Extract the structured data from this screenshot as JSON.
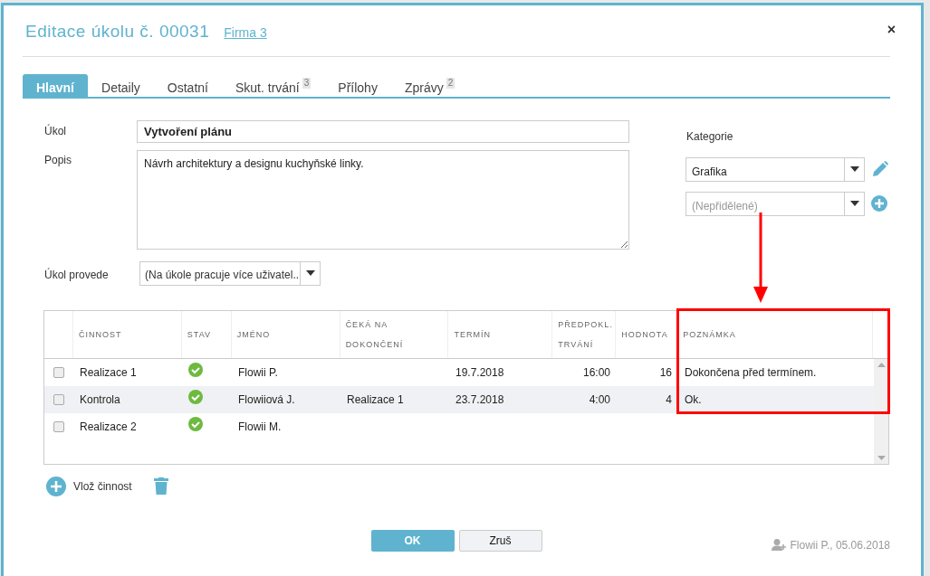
{
  "dialog": {
    "title": "Editace úkolu č. 00031",
    "company_link": "Firma 3",
    "close": "×"
  },
  "tabs": [
    {
      "label": "Hlavní",
      "selected": true
    },
    {
      "label": "Detaily",
      "selected": false
    },
    {
      "label": "Ostatní",
      "selected": false
    },
    {
      "label": "Skut. trvání",
      "badge": "3",
      "selected": false
    },
    {
      "label": "Přílohy",
      "selected": false
    },
    {
      "label": "Zprávy",
      "badge": "2",
      "selected": false
    }
  ],
  "form": {
    "task_label": "Úkol",
    "task_value": "Vytvoření plánu",
    "description_label": "Popis",
    "description_value": "Návrh architektury a designu kuchyňské linky.",
    "assignee_label": "Úkol provede",
    "assignee_value": "(Na úkole pracuje více uživatel...",
    "category_label": "Kategorie",
    "category_value": "Grafika",
    "subcategory_placeholder": "(Nepřidělené)"
  },
  "table": {
    "columns": [
      "ČINNOST",
      "STAV",
      "JMÉNO",
      "ČEKÁ NA DOKONČENÍ",
      "TERMÍN",
      "PŘEDPOKL. TRVÁNÍ",
      "HODNOTA",
      "POZNÁMKA"
    ],
    "rows": [
      {
        "checked": false,
        "activity": "Realizace 1",
        "completed": true,
        "name": "Flowii P.",
        "waits_for": "",
        "deadline": "19.7.2018",
        "estimated": "16:00",
        "value": "16",
        "note": "Dokončena před termínem."
      },
      {
        "checked": false,
        "activity": "Kontrola",
        "completed": true,
        "name": "Flowiiová J.",
        "waits_for": "Realizace 1",
        "deadline": "23.7.2018",
        "estimated": "4:00",
        "value": "4",
        "note": "Ok."
      },
      {
        "checked": false,
        "activity": "Realizace 2",
        "completed": true,
        "name": "Flowii M.",
        "waits_for": "",
        "deadline": "",
        "estimated": "",
        "value": "",
        "note": ""
      }
    ]
  },
  "add_activity": "Vlož činnost",
  "buttons": {
    "ok": "OK",
    "cancel": "Zruš"
  },
  "footer": {
    "created": "Flowii P., 05.06.2018"
  },
  "annotation": {
    "highlight_column": true,
    "arrow": true
  }
}
